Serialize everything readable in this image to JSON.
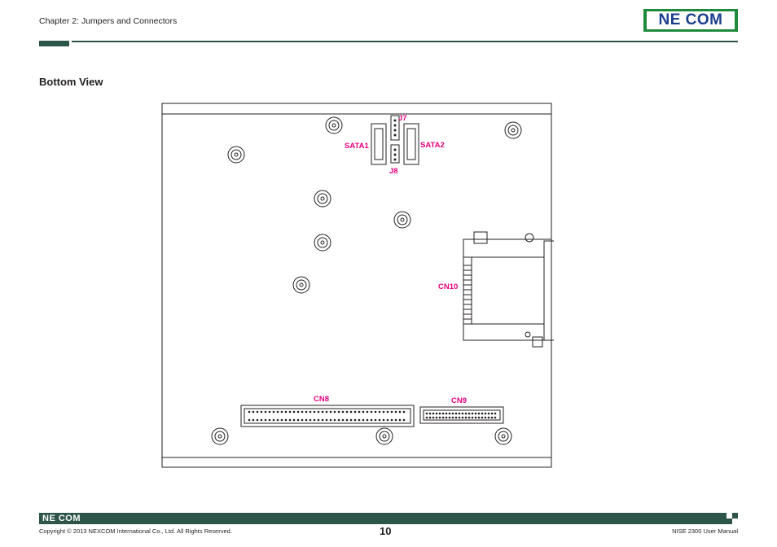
{
  "header": {
    "chapter": "Chapter 2: Jumpers and Connectors",
    "logo_text": "NE COM"
  },
  "section": {
    "title": "Bottom View"
  },
  "board": {
    "labels": {
      "j7": "J7",
      "sata1": "SATA1",
      "sata2": "SATA2",
      "j8": "J8",
      "cn10": "CN10",
      "cn8": "CN8",
      "cn9": "CN9"
    },
    "label_color": "#e6007e"
  },
  "footer": {
    "logo_text": "NE COM",
    "copyright": "Copyright © 2013 NEXCOM International Co., Ltd. All Rights Reserved.",
    "page_number": "10",
    "manual": "NISE 2300 User Manual",
    "bar_color": "#2d5549"
  }
}
